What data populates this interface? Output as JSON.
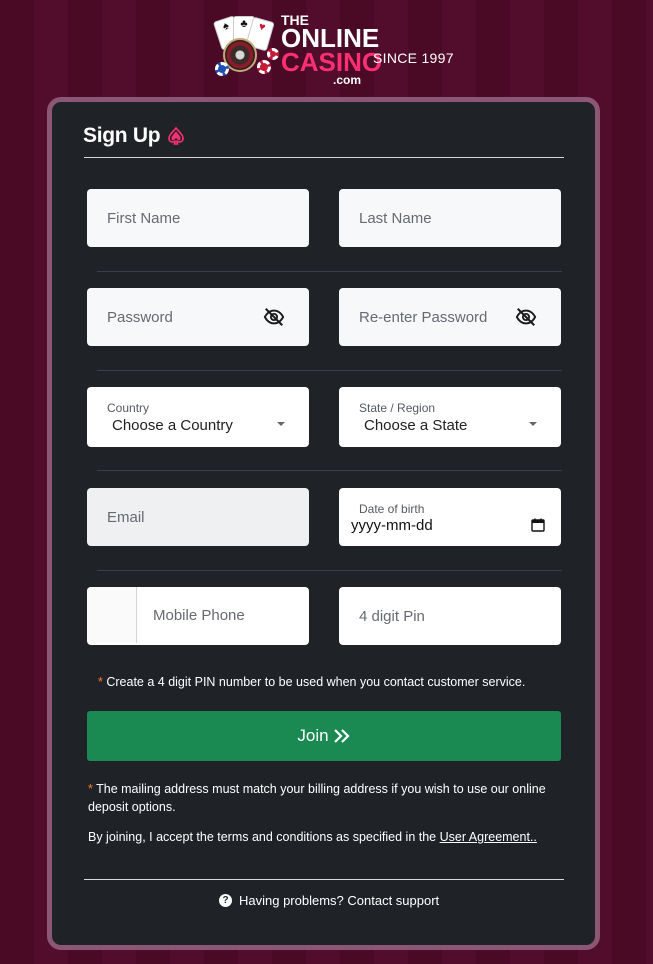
{
  "header": {
    "logo": {
      "the": "THE",
      "online": "ONLINE",
      "casino": "CASINO",
      "com": ".com"
    },
    "since": "SINCE 1997"
  },
  "form": {
    "title": "Sign Up",
    "first_name_placeholder": "First Name",
    "last_name_placeholder": "Last Name",
    "password_placeholder": "Password",
    "reenter_password_placeholder": "Re-enter Password",
    "country_label": "Country",
    "country_value": "Choose a Country",
    "state_label": "State / Region",
    "state_value": "Choose a State",
    "email_placeholder": "Email",
    "dob_label": "Date of birth",
    "dob_value": "yyyy-mm-dd",
    "mobile_placeholder": "Mobile Phone",
    "pin_placeholder": "4 digit Pin",
    "pin_note_star": "*",
    "pin_note": "Create a 4 digit PIN number to be used when you contact customer service.",
    "join_label": "Join",
    "mailing_note_star": "*",
    "mailing_note": "The mailing address must match your billing address if you wish to use our online deposit options.",
    "terms_text": "By joining, I accept the terms and conditions as specified in the",
    "agreement_link": "User Agreement..",
    "support_text": "Having problems? Contact support",
    "help_icon_glyph": "?"
  },
  "icons": {
    "spade": "spade-icon",
    "eye": "eye-slash-icon",
    "caret": "caret-down-icon",
    "calendar": "calendar-icon",
    "chevrons": "double-chevron-right-icon",
    "help": "question-circle-icon"
  },
  "colors": {
    "background": "#4a0a26",
    "panel": "#1f2328",
    "panel_border": "#8c5774",
    "accent_pink": "#ff2f72",
    "join_button": "#1a8a52",
    "note_star": "#ff7a2a"
  }
}
